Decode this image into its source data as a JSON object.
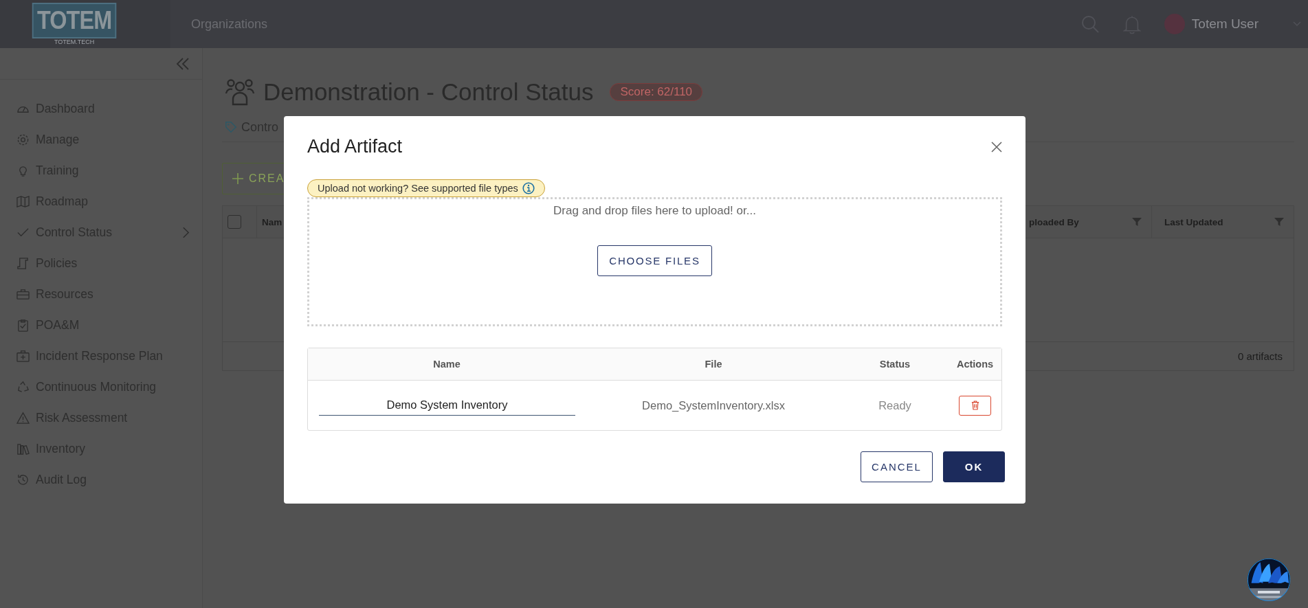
{
  "topbar": {
    "logo_text": "TOTEM",
    "logo_subtext": "TOTEM.TECH",
    "nav_item": "Organizations",
    "user_name": "Totem User"
  },
  "sidebar": {
    "items": [
      {
        "label": "Dashboard",
        "has_submenu": false
      },
      {
        "label": "Manage",
        "has_submenu": false
      },
      {
        "label": "Training",
        "has_submenu": false
      },
      {
        "label": "Roadmap",
        "has_submenu": false
      },
      {
        "label": "Control Status",
        "has_submenu": true
      },
      {
        "label": "Policies",
        "has_submenu": false
      },
      {
        "label": "Resources",
        "has_submenu": false
      },
      {
        "label": "POA&M",
        "has_submenu": false
      },
      {
        "label": "Incident Response Plan",
        "has_submenu": false
      },
      {
        "label": "Continuous Monitoring",
        "has_submenu": false
      },
      {
        "label": "Risk Assessment",
        "has_submenu": false
      },
      {
        "label": "Inventory",
        "has_submenu": false
      },
      {
        "label": "Audit Log",
        "has_submenu": false
      }
    ]
  },
  "page": {
    "title": "Demonstration - Control Status",
    "score_badge": "Score: 62/110",
    "tab_label": "Contro",
    "create_button": "CREA",
    "table": {
      "select_all": {
        "checked": false
      },
      "columns": [
        "Nam",
        "ploaded By",
        "Last Updated"
      ],
      "footer": "0 artifacts"
    }
  },
  "modal": {
    "title": "Add Artifact",
    "notice": "Upload not working? See supported file types",
    "dropzone_text": "Drag and drop files here to upload! or...",
    "choose_button": "CHOOSE FILES",
    "table": {
      "columns": [
        "Name",
        "File",
        "Status",
        "Actions"
      ],
      "rows": [
        {
          "name": "Demo System Inventory",
          "file": "Demo_SystemInventory.xlsx",
          "status": "Ready"
        }
      ]
    },
    "buttons": [
      {
        "label": "CANCEL",
        "kind": "secondary"
      },
      {
        "label": "OK",
        "kind": "primary"
      }
    ]
  }
}
